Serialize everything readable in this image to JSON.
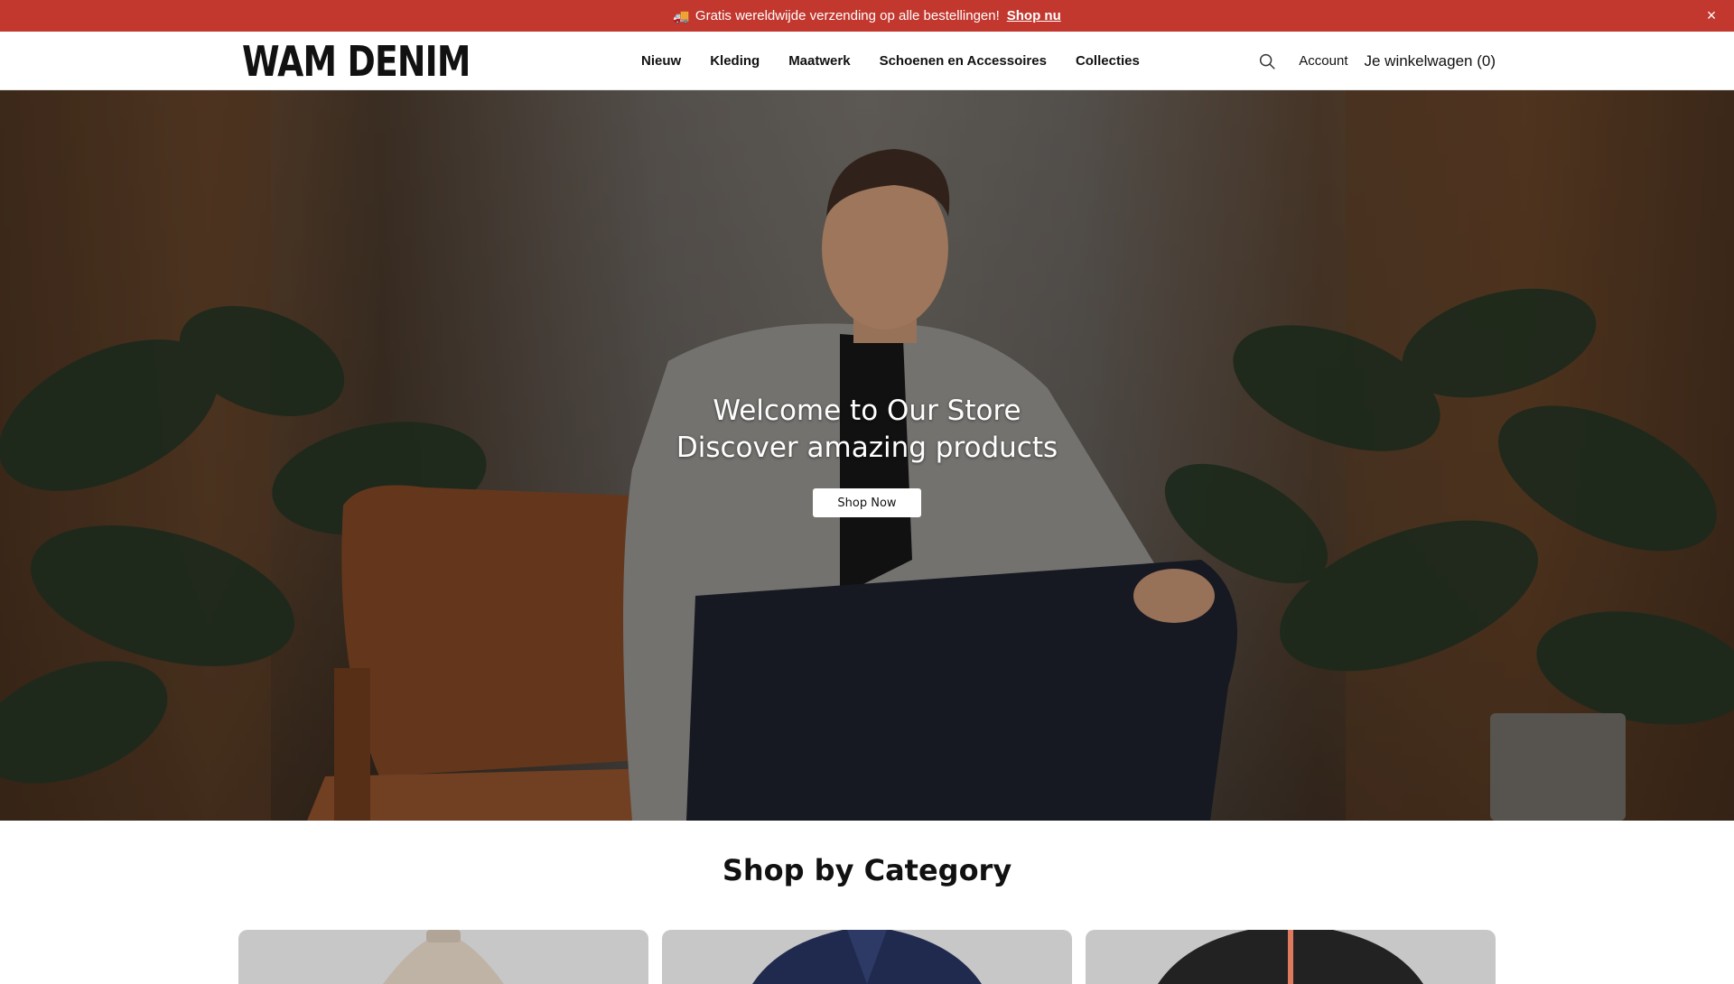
{
  "announcement": {
    "icon": "delivery-truck-icon",
    "text": "Gratis wereldwijde verzending op alle bestellingen!",
    "link_label": "Shop nu",
    "close_label": "×",
    "background": "#c2372e"
  },
  "header": {
    "logo": "WAM DENIM",
    "nav": [
      {
        "label": "Nieuw"
      },
      {
        "label": "Kleding"
      },
      {
        "label": "Maatwerk"
      },
      {
        "label": "Schoenen en Accessoires"
      },
      {
        "label": "Collecties"
      }
    ],
    "account_label": "Account",
    "cart_label": "Je winkelwagen (0)"
  },
  "hero": {
    "title_line1": "Welcome to Our Store",
    "title_line2": "Discover amazing products",
    "cta_label": "Shop Now"
  },
  "categories": {
    "title": "Shop by Category",
    "items": [
      {
        "icon": "beige-turtleneck-sweater"
      },
      {
        "icon": "navy-blazer"
      },
      {
        "icon": "black-bomber-jacket"
      }
    ]
  }
}
